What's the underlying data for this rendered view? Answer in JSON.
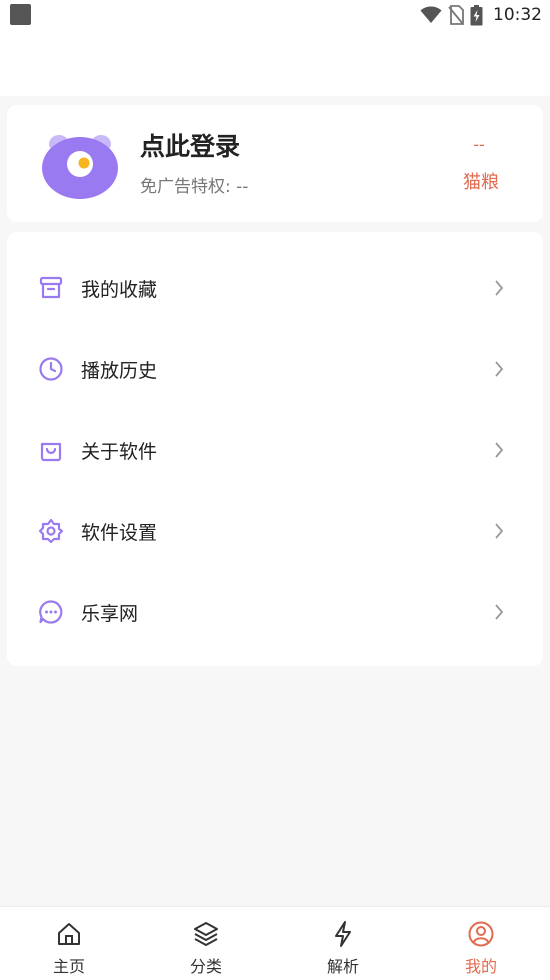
{
  "status_bar": {
    "time": "10:32",
    "icons": [
      "notification-square-icon",
      "wifi-icon",
      "no-sim-icon",
      "battery-charging-icon"
    ]
  },
  "profile": {
    "login_title": "点此登录",
    "ad_privilege_label": "免广告特权:",
    "ad_privilege_value": "--",
    "cat_food_value": "--",
    "cat_food_label": "猫粮",
    "avatar_color": "#9a7af0",
    "accent_color": "#e36b4f"
  },
  "menu": {
    "items": [
      {
        "label": "我的收藏",
        "icon": "archive-box-icon"
      },
      {
        "label": "播放历史",
        "icon": "clock-icon"
      },
      {
        "label": "关于软件",
        "icon": "shopping-bag-icon"
      },
      {
        "label": "软件设置",
        "icon": "settings-flower-icon"
      },
      {
        "label": "乐享网",
        "icon": "chat-bubble-icon"
      }
    ],
    "icon_color": "#9a7af0"
  },
  "bottom_nav": {
    "items": [
      {
        "label": "主页",
        "icon": "home-icon"
      },
      {
        "label": "分类",
        "icon": "layers-icon"
      },
      {
        "label": "解析",
        "icon": "lightning-icon"
      },
      {
        "label": "我的",
        "icon": "user-circle-icon",
        "active": true
      }
    ]
  }
}
